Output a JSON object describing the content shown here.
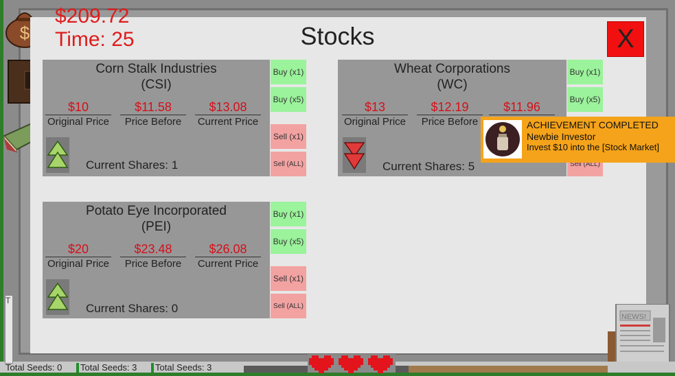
{
  "hud": {
    "money": "$209.72",
    "time": "Time: 25"
  },
  "window": {
    "title": "Stocks",
    "close_label": "X"
  },
  "stocks": [
    {
      "name": "Corn Stalk Industries",
      "ticker": "(CSI)",
      "original_price": "$10",
      "price_before": "$11.58",
      "current_price": "$13.08",
      "trend": "up",
      "shares": "Current Shares: 1"
    },
    {
      "name": "Wheat Corporations",
      "ticker": "(WC)",
      "original_price": "$13",
      "price_before": "$12.19",
      "current_price": "$11.96",
      "trend": "down",
      "shares": "Current Shares: 5"
    },
    {
      "name": "Potato Eye Incorporated",
      "ticker": "(PEI)",
      "original_price": "$20",
      "price_before": "$23.48",
      "current_price": "$26.08",
      "trend": "up",
      "shares": "Current Shares: 0"
    }
  ],
  "labels": {
    "original_price": "Original Price",
    "price_before": "Price Before",
    "current_price": "Current Price",
    "buy_x1": "Buy (x1)",
    "buy_x5": "Buy (x5)",
    "sell_x1": "Sell (x1)",
    "sell_all": "Sell (ALL)"
  },
  "achievement": {
    "header": "ACHIEVEMENT COMPLETED",
    "name": "Newbie Investor",
    "description": "Invest $10 into the [Stock Market]"
  },
  "bottom": {
    "seeds": [
      "Total Seeds: 0",
      "Total Seeds: 3",
      "Total Seeds: 3"
    ],
    "lives": 3
  },
  "colors": {
    "price_red": "#d4101a",
    "buy_green": "#9bf39b",
    "sell_red": "#f3a2a2",
    "achievement_orange": "#f5a31a",
    "close_red": "#f20f0f"
  },
  "icons": [
    "money-bag-icon",
    "journal-icon",
    "spellbook-icon",
    "alert-badge-icon",
    "trend-up-icon",
    "trend-down-icon",
    "heart-icon",
    "newspaper-icon",
    "coin-jar-icon"
  ]
}
